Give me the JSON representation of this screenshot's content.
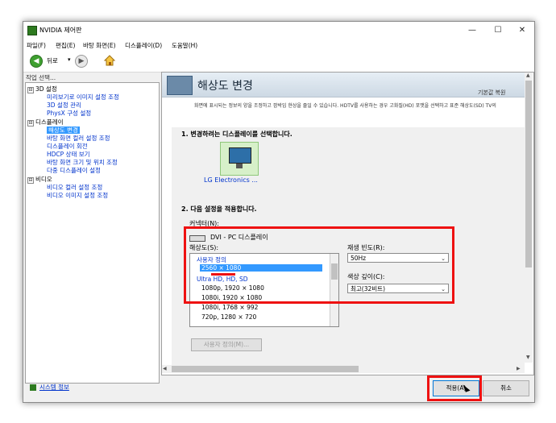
{
  "window": {
    "title": "NVIDIA 제어판",
    "minimize_glyph": "—",
    "maximize_glyph": "☐",
    "close_glyph": "✕"
  },
  "menu": [
    "파일(F)",
    "편집(E)",
    "바탕 화면(E)",
    "디스플레이(D)",
    "도움말(H)"
  ],
  "toolbar": {
    "back_label": "뒤로",
    "back_glyph": "◀",
    "forward_glyph": "▶",
    "dropdown_glyph": "▾",
    "home_icon": "home-icon"
  },
  "task_pane_label": "작업 선택...",
  "tree": {
    "cat_3d": "3D 설정",
    "items_3d": [
      "미리보기로 이미지 설정 조정",
      "3D 설정 관리",
      "PhysX 구성 설정"
    ],
    "cat_display": "디스플레이",
    "items_display": [
      "해상도 변경",
      "바탕 화면 컬러 설정 조정",
      "디스플레이 회전",
      "HDCP 상태 보기",
      "바탕 화면 크기 및 위치 조정",
      "다중 디스플레이 설정"
    ],
    "cat_video": "비디오",
    "items_video": [
      "비디오 컬러 설정 조정",
      "비디오 이미지 설정 조정"
    ],
    "expand_glyph": "⊟"
  },
  "system_info": "시스템 정보",
  "page": {
    "title": "해상도 변경",
    "restore_defaults": "기본값 복원",
    "description": "화면에 표시되는 정보의 양을 조정하고 깜박임 현상을 줄일 수 있습니다. HDTV를 사용하는 경우 고화질(HD) 포맷을 선택하고 표준 해상도(SD) TV의",
    "step1": "1. 변경하려는 디스플레이를 선택합니다.",
    "monitor_label": "LG Electronics ...",
    "step2": "2. 다음 설정을 적용합니다.",
    "connector_label": "커넥터(N):",
    "connector_value": "DVI - PC 디스플레이",
    "resolution_label": "해상도(S):",
    "resolution_list": [
      {
        "text": "사용자 정의",
        "kind": "group"
      },
      {
        "text": "2560 × 1080",
        "kind": "selected"
      },
      {
        "text": "Ultra HD, HD, SD",
        "kind": "group"
      },
      {
        "text": "1080p, 1920 × 1080",
        "kind": "item"
      },
      {
        "text": "1080i, 1920 × 1080",
        "kind": "item"
      },
      {
        "text": "1080i, 1768 × 992",
        "kind": "item"
      },
      {
        "text": "720p, 1280 × 720",
        "kind": "item"
      }
    ],
    "refresh_label": "재생 빈도(R):",
    "refresh_value": "50Hz",
    "color_depth_label": "색상 깊이(C):",
    "color_depth_value": "최고(32비트)",
    "custom_button": "사용자 정의(M)...",
    "chevron_glyph": "⌄"
  },
  "buttons": {
    "apply": "적용(A)",
    "cancel": "취소"
  },
  "colors": {
    "highlight_red": "#ee1111",
    "selection_blue": "#3399ff",
    "nvidia_green": "#2d7a1f"
  }
}
